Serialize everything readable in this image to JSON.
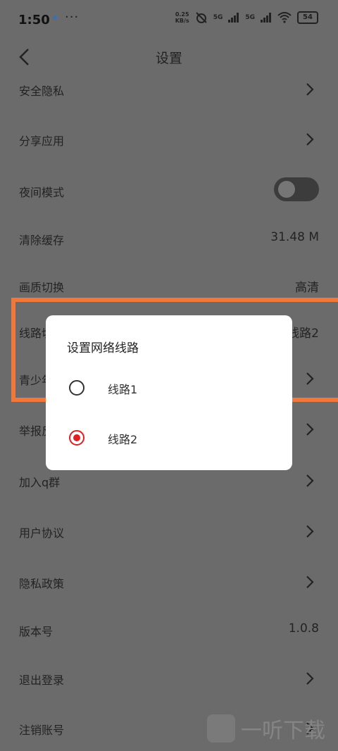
{
  "status_bar": {
    "time": "1:50",
    "more": "···",
    "speed_top": "0.25",
    "speed_bottom": "KB/s",
    "sig1": "5G",
    "sig2": "5G",
    "battery": "54"
  },
  "header": {
    "title": "设置"
  },
  "rows": [
    {
      "label": "安全隐私"
    },
    {
      "label": "分享应用"
    },
    {
      "label": "夜间模式"
    },
    {
      "label": "清除缓存",
      "value": "31.48 M"
    },
    {
      "label": "画质切换",
      "value": "高清"
    },
    {
      "label": "线路切",
      "value": "线路2"
    },
    {
      "label": "青少年"
    },
    {
      "label": "举报反"
    },
    {
      "label": "加入q群"
    },
    {
      "label": "用户协议"
    },
    {
      "label": "隐私政策"
    },
    {
      "label": "版本号",
      "value": "1.0.8"
    },
    {
      "label": "退出登录"
    },
    {
      "label": "注销账号"
    }
  ],
  "dialog": {
    "title": "设置网络线路",
    "options": [
      {
        "label": "线路1",
        "selected": false
      },
      {
        "label": "线路2",
        "selected": true
      }
    ]
  },
  "colors": {
    "highlight": "#f0783a",
    "selected_radio": "#e02020",
    "overlay": "#6b6b6b"
  },
  "watermark": {
    "text": "一听下载"
  }
}
